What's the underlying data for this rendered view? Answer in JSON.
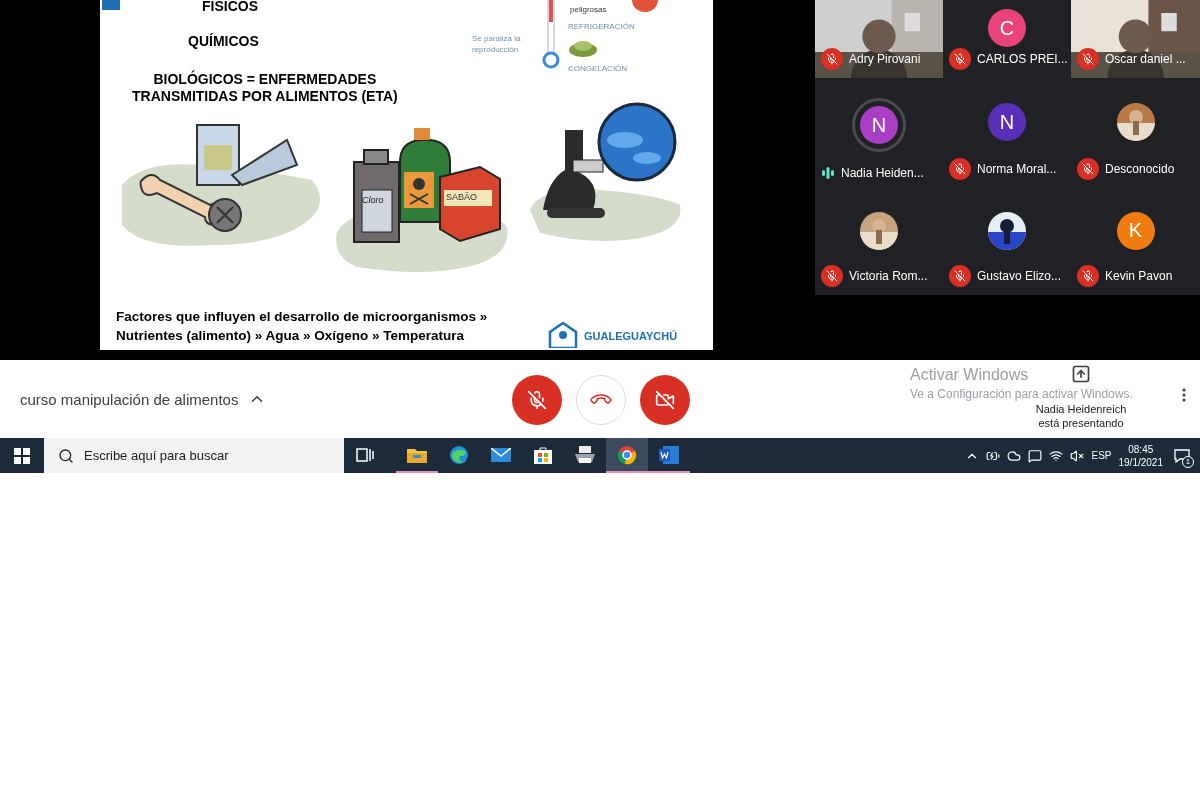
{
  "slide": {
    "categories": [
      {
        "label": "FISICOS"
      },
      {
        "label": "QUÍMICOS"
      },
      {
        "label": "BIOLÓGICOS = ENFERMEDADES\nTRANSMITIDAS POR ALIMENTOS (ETA)"
      }
    ],
    "thermometer": {
      "danger_label": "peligrosas",
      "refrigeration": "REFRIGERACIÓN",
      "freezing": "CONGELACIÓN",
      "note": "Se paraliza la\nreproducción"
    },
    "bottle_label": "Cloro",
    "box_label": "SABÃO",
    "footer": "Factores que influyen el desarrollo de microorganismos »\nNutrientes (alimento) » Agua » Oxígeno » Temperatura",
    "logo": "GUALEGUAYCHÚ"
  },
  "participants": [
    {
      "name": "Adry Pirovani",
      "kind": "video",
      "muted": true
    },
    {
      "name": "CARLOS PREI...",
      "kind": "letter",
      "initial": "C",
      "color": "#e8437a",
      "muted": true
    },
    {
      "name": "Oscar daniel ...",
      "kind": "video",
      "muted": true
    },
    {
      "name": "Nadia Heiden...",
      "kind": "letter",
      "initial": "N",
      "color": "#a93fc4",
      "muted": false
    },
    {
      "name": "Norma Moral...",
      "kind": "letter",
      "initial": "N",
      "color": "#5a2fb8",
      "muted": true
    },
    {
      "name": "Desconocido",
      "muted": true
    },
    {
      "name": "Victoria Rom...",
      "muted": true
    },
    {
      "name": "Gustavo Elizo...",
      "muted": true
    },
    {
      "name": "Kevin Pavon",
      "kind": "letter",
      "initial": "K",
      "color": "#f07c0f",
      "muted": true
    }
  ],
  "meeting": {
    "title": "curso manipulación de alimentos",
    "presenting": "Nadia Heidenreich\nestá presentando"
  },
  "activation": {
    "title": "Activar Windows",
    "subtitle": "Ve a Configuración para activar Windows."
  },
  "taskbar": {
    "search_placeholder": "Escribe aquí para buscar",
    "apps": [
      {
        "kind": "explorer",
        "running": true,
        "selected": false
      },
      {
        "kind": "edge",
        "running": false,
        "selected": false
      },
      {
        "kind": "mail",
        "running": false,
        "selected": false
      },
      {
        "kind": "store",
        "running": false,
        "selected": false
      },
      {
        "kind": "printer",
        "running": false,
        "selected": false
      },
      {
        "kind": "chrome",
        "running": true,
        "selected": true
      },
      {
        "kind": "word",
        "running": true,
        "selected": false
      }
    ],
    "language": "ESP",
    "time": "08:45",
    "date": "19/1/2021",
    "notifications": "1"
  }
}
